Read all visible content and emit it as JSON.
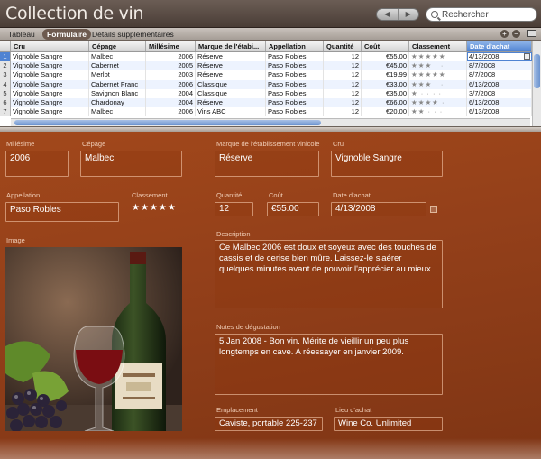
{
  "app": {
    "title": "Collection de vin"
  },
  "nav": {
    "back": "◀",
    "forward": "▶"
  },
  "search": {
    "placeholder": "Rechercher"
  },
  "tabs": [
    {
      "label": "Tableau"
    },
    {
      "label": "Formulaire"
    },
    {
      "label": "Détails supplémentaires"
    }
  ],
  "toolbar": {
    "add": "+",
    "remove": "−"
  },
  "table": {
    "columns": [
      "Cru",
      "Cépage",
      "Millésime",
      "Marque de l'étabi...",
      "Appellation",
      "Quantité",
      "Coût",
      "Classement",
      "Date d'achat"
    ],
    "rows": [
      {
        "n": "1",
        "cru": "Vignoble Sangre",
        "cepage": "Malbec",
        "millesime": "2006",
        "marque": "Réserve",
        "appellation": "Paso Robles",
        "quantite": "12",
        "cout": "€55.00",
        "stars": "★★★★★",
        "date": "4/13/2008"
      },
      {
        "n": "2",
        "cru": "Vignoble Sangre",
        "cepage": "Cabernet",
        "millesime": "2005",
        "marque": "Réserve",
        "appellation": "Paso Robles",
        "quantite": "12",
        "cout": "€45.00",
        "stars": "★★★ · ·",
        "date": "8/7/2008"
      },
      {
        "n": "3",
        "cru": "Vignoble Sangre",
        "cepage": "Merlot",
        "millesime": "2003",
        "marque": "Réserve",
        "appellation": "Paso Robles",
        "quantite": "12",
        "cout": "€19.99",
        "stars": "★★★★★",
        "date": "8/7/2008"
      },
      {
        "n": "4",
        "cru": "Vignoble Sangre",
        "cepage": "Cabernet Franc",
        "millesime": "2006",
        "marque": "Classique",
        "appellation": "Paso Robles",
        "quantite": "12",
        "cout": "€33.00",
        "stars": "★★★ · ·",
        "date": "6/13/2008"
      },
      {
        "n": "5",
        "cru": "Vignoble Sangre",
        "cepage": "Savignon Blanc",
        "millesime": "2004",
        "marque": "Classique",
        "appellation": "Paso Robles",
        "quantite": "12",
        "cout": "€35.00",
        "stars": "★ · · · ·",
        "date": "3/7/2008"
      },
      {
        "n": "6",
        "cru": "Vignoble Sangre",
        "cepage": "Chardonay",
        "millesime": "2004",
        "marque": "Réserve",
        "appellation": "Paso Robles",
        "quantite": "12",
        "cout": "€66.00",
        "stars": "★★★★ ·",
        "date": "6/13/2008"
      },
      {
        "n": "7",
        "cru": "Vignoble Sangre",
        "cepage": "Malbec",
        "millesime": "2006",
        "marque": "Vins ABC",
        "appellation": "Paso Robles",
        "quantite": "12",
        "cout": "€20.00",
        "stars": "★★ · · ·",
        "date": "6/13/2008"
      }
    ]
  },
  "form": {
    "millesime": {
      "label": "Millésime",
      "value": "2006"
    },
    "cepage": {
      "label": "Cépage",
      "value": "Malbec"
    },
    "marque": {
      "label": "Marque de l'établissement vinicole",
      "value": "Réserve"
    },
    "cru": {
      "label": "Cru",
      "value": "Vignoble Sangre"
    },
    "appellation": {
      "label": "Appellation",
      "value": "Paso Robles"
    },
    "classement": {
      "label": "Classement",
      "value": "★★★★★"
    },
    "quantite": {
      "label": "Quantité",
      "value": "12"
    },
    "cout": {
      "label": "Coût",
      "value": "€55.00"
    },
    "date_achat": {
      "label": "Date d'achat",
      "value": "4/13/2008"
    },
    "image": {
      "label": "Image"
    },
    "description": {
      "label": "Description",
      "value": "Ce Malbec 2006 est doux et soyeux avec des touches de cassis et de cerise bien mûre. Laissez-le s'aérer quelques minutes avant de pouvoir l'apprécier au mieux."
    },
    "notes": {
      "label": "Notes de dégustation",
      "value": "5 Jan 2008 - Bon vin. Mérite de vieillir un peu plus  longtemps en cave. A réessayer en janvier 2009."
    },
    "emplacement": {
      "label": "Emplacement",
      "value": "Caviste, portable 225-237"
    },
    "lieu": {
      "label": "Lieu d'achat",
      "value": "Wine Co. Unlimited"
    }
  },
  "colors": {
    "accent": "#4f83d2",
    "form_bg": "#94401a"
  }
}
